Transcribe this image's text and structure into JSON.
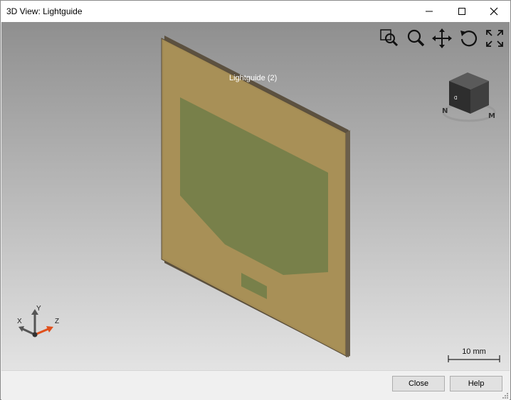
{
  "window": {
    "title": "3D View: Lightguide"
  },
  "titlebar_buttons": {
    "minimize": "minimize-icon",
    "maximize": "maximize-icon",
    "close": "close-icon"
  },
  "viewport": {
    "object_label": "Lightguide (2)",
    "tools": [
      "zoom-to-fit-icon",
      "zoom-icon",
      "pan-icon",
      "rotate-icon",
      "fullscreen-icon"
    ],
    "view_cube": {
      "label": "view-cube",
      "letters": [
        "N",
        "M"
      ]
    },
    "axes": {
      "x": "X",
      "y": "Y",
      "z": "Z"
    },
    "scale_bar": "10 mm",
    "colors": {
      "panel": "#a48c55",
      "panel_edge": "#5a4e3a",
      "region": "#7a7f45",
      "accent": "#e0501c"
    }
  },
  "footer": {
    "close_label": "Close",
    "help_label": "Help"
  }
}
